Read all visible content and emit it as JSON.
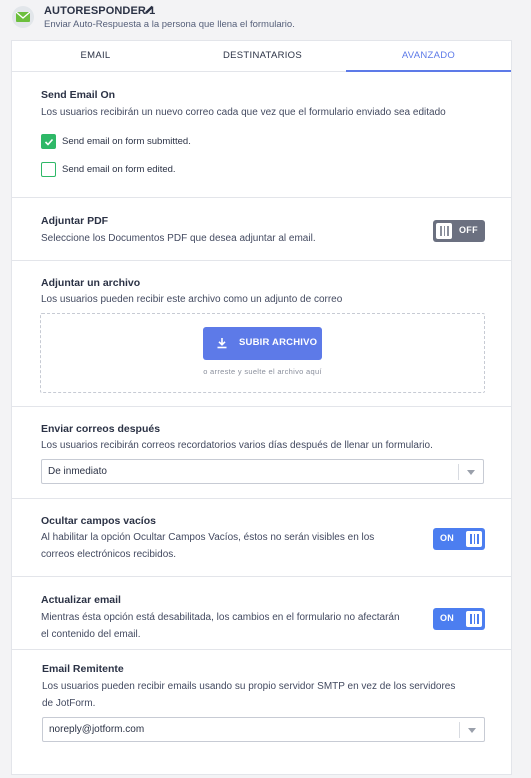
{
  "header": {
    "title": "AUTORESPONDER 1",
    "subtitle": "Enviar Auto-Respuesta a la persona que llena el formulario."
  },
  "tabs": [
    {
      "label": "EMAIL",
      "active": false
    },
    {
      "label": "DESTINATARIOS",
      "active": false
    },
    {
      "label": "AVANZADO",
      "active": true
    }
  ],
  "send_email_on": {
    "title": "Send Email On",
    "description": "Los usuarios recibirán un nuevo correo cada que vez que el formulario enviado sea editado",
    "options": [
      {
        "label": "Send email on form submitted.",
        "checked": true
      },
      {
        "label": "Send email on form edited.",
        "checked": false
      }
    ]
  },
  "attach_pdf": {
    "title": "Adjuntar PDF",
    "description": "Seleccione los Documentos PDF que desea adjuntar al email.",
    "toggle_label": "OFF",
    "enabled": false
  },
  "attach_file": {
    "title": "Adjuntar un archivo",
    "description": "Los usuarios pueden recibir este archivo como un adjunto de correo",
    "upload_label": "SUBIR ARCHIVO",
    "drop_hint": "o arreste y suelte el archivo aquí"
  },
  "send_after": {
    "title": "Enviar correos después",
    "description": "Los usuarios recibirán correos recordatorios varios días después de llenar un formulario.",
    "selected": "De inmediato"
  },
  "hide_empty": {
    "title": "Ocultar campos vacíos",
    "description_line1": "Al habilitar la opción Ocultar Campos Vacíos, éstos no serán visibles en los",
    "description_line2": "correos electrónicos recibidos.",
    "toggle_label": "ON",
    "enabled": true
  },
  "update_email": {
    "title": "Actualizar email",
    "description_line1": "Mientras ésta opción está desabilitada, los cambios en el formulario no afectarán",
    "description_line2": "el contenido del email.",
    "toggle_label": "ON",
    "enabled": true
  },
  "sender_email": {
    "title": "Email Remitente",
    "description_line1": "Los usuarios pueden recibir emails usando su propio servidor SMTP en vez de los servidores",
    "description_line2": "de JotForm.",
    "selected": "noreply@jotform.com"
  },
  "colors": {
    "accent": "#5d7ae8",
    "toggle_on": "#4c7ef0",
    "toggle_off": "#6b7080",
    "checkbox": "#2eb867"
  }
}
